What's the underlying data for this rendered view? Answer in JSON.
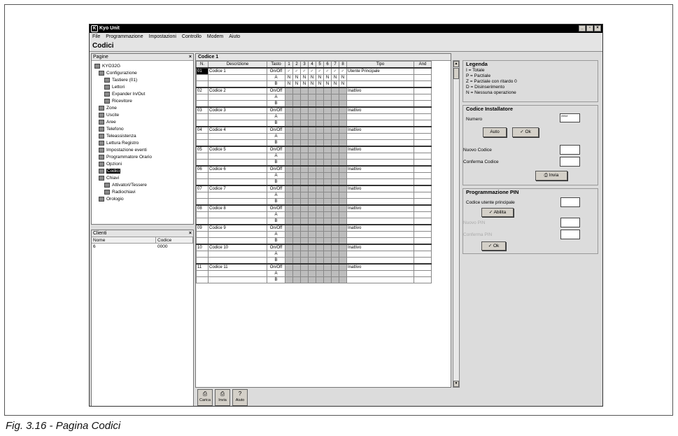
{
  "window": {
    "title": "Kyo Unit",
    "app_icon": "app-icon",
    "buttons": [
      "_",
      "▫",
      "×"
    ]
  },
  "menu": [
    "File",
    "Programmazione",
    "Impostazioni",
    "Controllo",
    "Modem",
    "Aiuto"
  ],
  "page_title": "Codici",
  "pagine": {
    "header": "Pagine",
    "close": "×",
    "tree": [
      {
        "label": "KYO32G",
        "icon": "panel-icon"
      },
      {
        "label": "Configurazione",
        "icon": "config-icon"
      },
      {
        "label": "Tastiere (01)",
        "icon": "keypad-icon"
      },
      {
        "label": "Lettori",
        "icon": "reader-icon"
      },
      {
        "label": "Expander In/Out",
        "icon": "expander-icon"
      },
      {
        "label": "Ricevitore",
        "icon": "receiver-icon"
      },
      {
        "label": "Zone",
        "icon": "zone-icon"
      },
      {
        "label": "Uscite",
        "icon": "output-icon"
      },
      {
        "label": "Aree",
        "icon": "area-icon"
      },
      {
        "label": "Telefono",
        "icon": "phone-icon"
      },
      {
        "label": "Teleassistenza",
        "icon": "teleassist-icon"
      },
      {
        "label": "Lettura Registro",
        "icon": "log-icon"
      },
      {
        "label": "Impostazione eventi",
        "icon": "events-icon"
      },
      {
        "label": "Programmatore Orario",
        "icon": "scheduler-icon"
      },
      {
        "label": "Opzioni",
        "icon": "options-icon"
      },
      {
        "label": "Codici",
        "icon": "codes-icon"
      },
      {
        "label": "Chiavi",
        "icon": "keys-icon"
      },
      {
        "label": "Attivatori/Tessere",
        "icon": "activator-icon"
      },
      {
        "label": "Radiochiavi",
        "icon": "radiokey-icon"
      },
      {
        "label": "Orologio",
        "icon": "clock-icon"
      }
    ]
  },
  "clienti": {
    "header": "Clienti",
    "close": "×",
    "columns": [
      "Nome",
      "Codice"
    ],
    "rows": [
      [
        "6",
        "0000"
      ]
    ]
  },
  "grid": {
    "title": "Codice 1",
    "headers": [
      "N.",
      "Descrizione",
      "Tasto",
      "1",
      "2",
      "3",
      "4",
      "5",
      "6",
      "7",
      "8",
      "Tipo",
      "And"
    ],
    "rows": [
      {
        "n": "01",
        "desc": "Codice 1",
        "tipo": "Utente Principale"
      },
      {
        "n": "02",
        "desc": "Codice 2",
        "tipo": "Inattivo"
      },
      {
        "n": "03",
        "desc": "Codice 3",
        "tipo": "Inattivo"
      },
      {
        "n": "04",
        "desc": "Codice 4",
        "tipo": "Inattivo"
      },
      {
        "n": "05",
        "desc": "Codice 5",
        "tipo": "Inattivo"
      },
      {
        "n": "06",
        "desc": "Codice 6",
        "tipo": "Inattivo"
      },
      {
        "n": "07",
        "desc": "Codice 7",
        "tipo": "Inattivo"
      },
      {
        "n": "08",
        "desc": "Codice 8",
        "tipo": "Inattivo"
      },
      {
        "n": "09",
        "desc": "Codice 9",
        "tipo": "Inattivo"
      },
      {
        "n": "10",
        "desc": "Codice 10",
        "tipo": "Inattivo"
      },
      {
        "n": "11",
        "desc": "Codice 11",
        "tipo": "Inattivo"
      }
    ],
    "tasti": [
      "On/Off",
      "A",
      "B"
    ],
    "n_value": "N",
    "check": "✓"
  },
  "legenda": {
    "title": "Legenda",
    "lines": [
      "I =   Totale",
      "P =   Parziale",
      "Z =   Parziale con ritardo 0",
      "D =   Disinserimento",
      "N =   Nessuna operazione"
    ]
  },
  "installatore": {
    "title": "Codice Installatore",
    "numero_label": "Numero",
    "numero_value": "****",
    "auto_button": "Auto",
    "ok_button": "✓  Ok",
    "nuovo_label": "Nuovo Codice",
    "conferma_label": "Conferma Codice",
    "invia_button": "Invia"
  },
  "pin": {
    "title": "Programmazione PIN",
    "codice_label": "Codice utente principale",
    "abilita_button": "✓  Abilita",
    "nuovo_pin_label": "Nuovo PIN",
    "conferma_pin_label": "Conferma PIN",
    "ok_button": "✓  Ok"
  },
  "toolbar": [
    {
      "label": "Carica",
      "icon": "load-icon"
    },
    {
      "label": "Invia",
      "icon": "send-icon"
    },
    {
      "label": "Aiuto",
      "icon": "help-icon"
    }
  ],
  "caption": "Fig. 3.16 - Pagina Codici"
}
